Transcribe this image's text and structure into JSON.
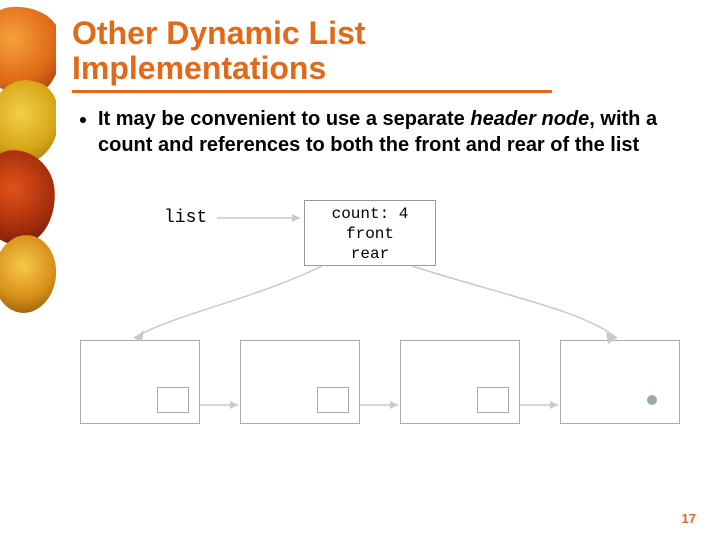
{
  "title_line1": "Other Dynamic List",
  "title_line2": "Implementations",
  "bullet": {
    "prefix": "It may be convenient to use a separate ",
    "header_node": "header node",
    "suffix": ", with a count and references to both the front and rear of the list"
  },
  "diagram": {
    "list_label": "list",
    "header_box_line1": "count: 4",
    "header_box_line2": "front",
    "header_box_line3": "rear"
  },
  "page_number": "17"
}
